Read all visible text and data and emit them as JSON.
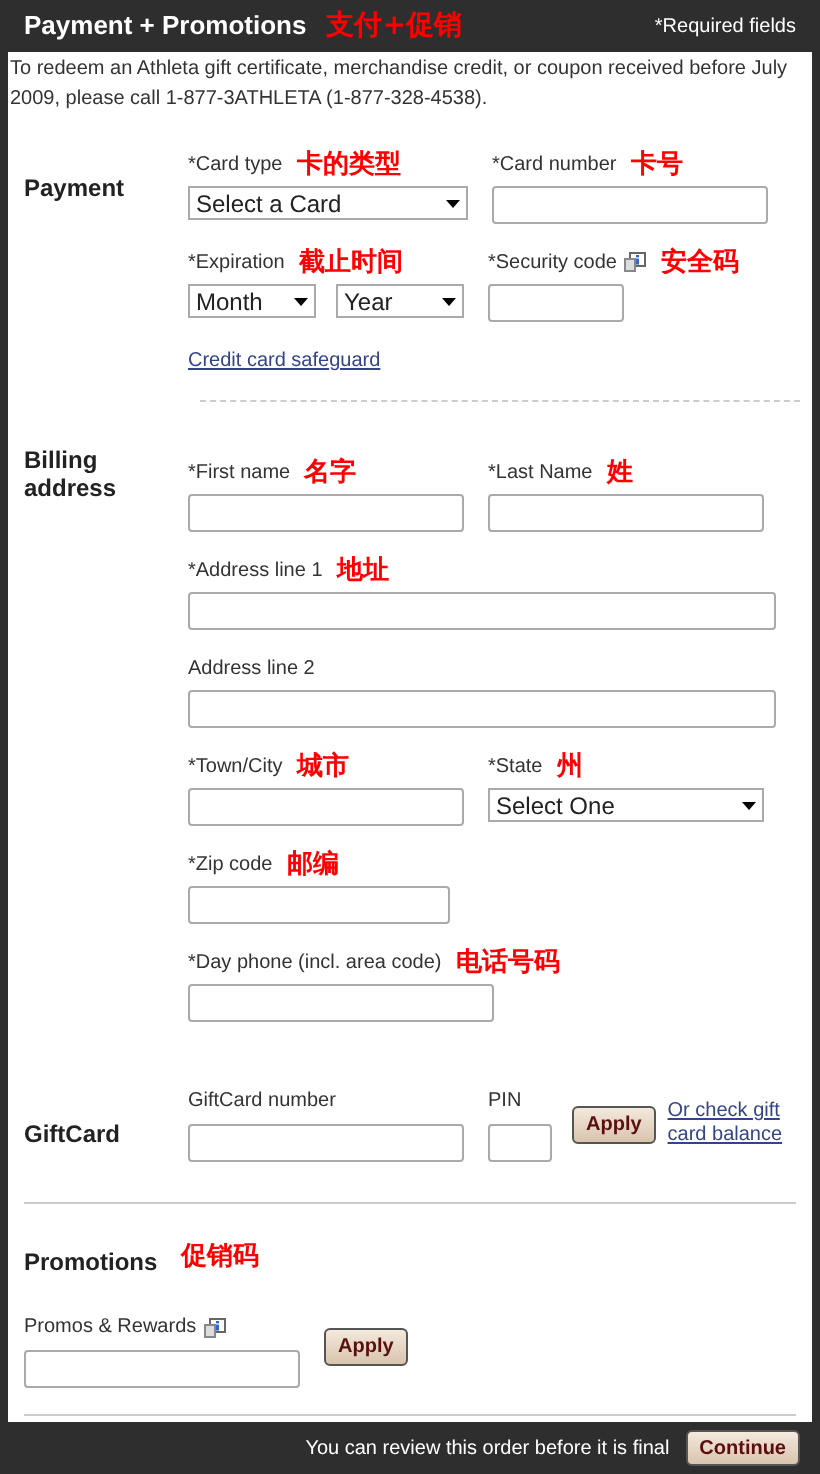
{
  "header": {
    "title": "Payment + Promotions",
    "note": "支付+促销",
    "required": "*Required fields"
  },
  "intro": "To redeem an Athleta gift certificate, merchandise credit, or coupon received before July 2009, please call 1-877-3ATHLETA (1-877-328-4538).",
  "payment": {
    "title": "Payment",
    "card_type": {
      "label": "*Card type",
      "note": "卡的类型",
      "value": "Select a Card"
    },
    "card_number": {
      "label": "*Card number",
      "note": "卡号"
    },
    "expiration": {
      "label": "*Expiration",
      "note": "截止时间",
      "month": "Month",
      "year": "Year"
    },
    "security_code": {
      "label": "*Security code",
      "note": "安全码"
    },
    "safeguard_link": "Credit card safeguard"
  },
  "billing": {
    "title": "Billing address",
    "first_name": {
      "label": "*First name",
      "note": "名字"
    },
    "last_name": {
      "label": "*Last Name",
      "note": "姓"
    },
    "address1": {
      "label": "*Address line 1",
      "note": "地址"
    },
    "address2": {
      "label": "Address line 2"
    },
    "town": {
      "label": "*Town/City",
      "note": "城市"
    },
    "state": {
      "label": "*State",
      "note": "州",
      "value": "Select One"
    },
    "zip": {
      "label": "*Zip code",
      "note": "邮编"
    },
    "phone": {
      "label": "*Day phone (incl. area code)",
      "note": "电话号码"
    }
  },
  "giftcard": {
    "title": "GiftCard",
    "number_label": "GiftCard number",
    "pin_label": "PIN",
    "apply": "Apply",
    "balance_link": "Or check gift card balance"
  },
  "promotions": {
    "title": "Promotions",
    "note": "促销码",
    "field_label": "Promos & Rewards",
    "apply": "Apply"
  },
  "footer": {
    "text": "You can review this order before it is final",
    "continue": "Continue"
  }
}
